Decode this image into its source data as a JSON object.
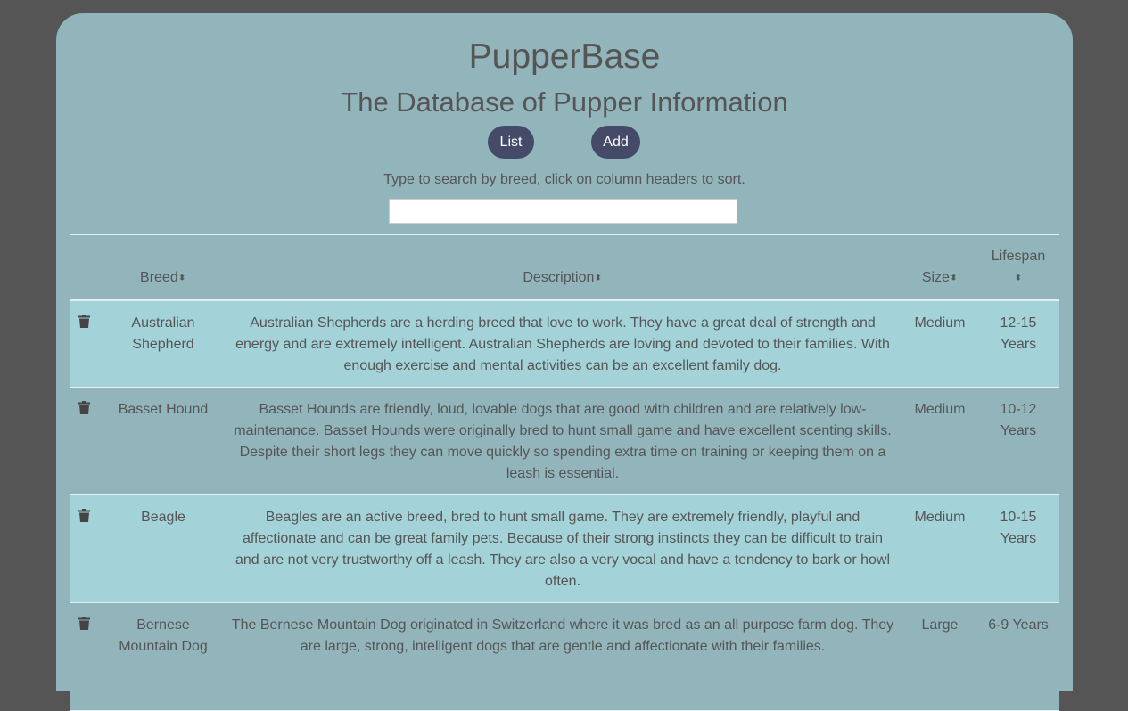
{
  "app": {
    "title": "PupperBase",
    "subtitle": "The Database of Pupper Information"
  },
  "nav": {
    "list_label": "List",
    "add_label": "Add"
  },
  "search": {
    "hint": "Type to search by breed, click on column headers to sort.",
    "value": "",
    "placeholder": ""
  },
  "table": {
    "headers": {
      "breed": "Breed",
      "description": "Description",
      "size": "Size",
      "lifespan": "Lifespan"
    },
    "sort_icon": "sort-icon",
    "delete_icon": "trash-icon",
    "rows": [
      {
        "breed": "Australian Shepherd",
        "description": "Australian Shepherds are a herding breed that love to work. They have a great deal of strength and energy and are extremely intelligent. Australian Shepherds are loving and devoted to their families. With enough exercise and mental activities can be an excellent family dog.",
        "size": "Medium",
        "lifespan": "12-15 Years"
      },
      {
        "breed": "Basset Hound",
        "description": "Basset Hounds are friendly, loud, lovable dogs that are good with children and are relatively low-maintenance. Basset Hounds were originally bred to hunt small game and have excellent scenting skills. Despite their short legs they can move quickly so spending extra time on training or keeping them on a leash is essential.",
        "size": "Medium",
        "lifespan": "10-12 Years"
      },
      {
        "breed": "Beagle",
        "description": "Beagles are an active breed, bred to hunt small game. They are extremely friendly, playful and affectionate and can be great family pets. Because of their strong instincts they can be difficult to train and are not very trustworthy off a leash. They are also a very vocal and have a tendency to bark or howl often.",
        "size": "Medium",
        "lifespan": "10-15 Years"
      },
      {
        "breed": "Bernese Mountain Dog",
        "description": "The Bernese Mountain Dog originated in Switzerland where it was bred as an all purpose farm dog. They are large, strong, intelligent dogs that are gentle and affectionate with their families.",
        "size": "Large",
        "lifespan": "6-9 Years"
      }
    ]
  },
  "colors": {
    "page_bg": "#555555",
    "card_bg": "#91b5bb",
    "row_odd_bg": "#a3d2d8",
    "row_even_bg": "#92b5bb",
    "button_bg": "#444a68",
    "text": "#555555"
  }
}
